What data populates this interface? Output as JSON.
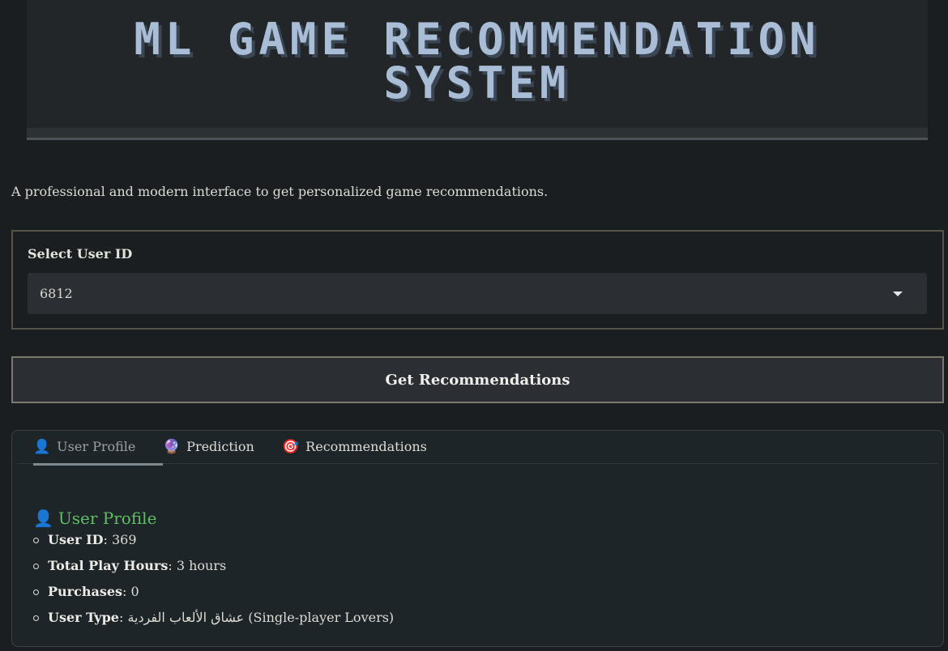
{
  "header": {
    "title_line1": "ML GAME RECOMMENDATION",
    "title_line2": "SYSTEM"
  },
  "subtitle": "A professional and modern interface to get personalized game recommendations.",
  "user_select": {
    "label": "Select User ID",
    "value": "6812",
    "icon": "chevron-down-icon"
  },
  "actions": {
    "get_recommendations_label": "Get Recommendations"
  },
  "tabs": [
    {
      "icon": "👤",
      "icon_name": "user-icon",
      "label": "User Profile",
      "active": true
    },
    {
      "icon": "🔮",
      "icon_name": "crystal-ball-icon",
      "label": "Prediction",
      "active": false
    },
    {
      "icon": "🎯",
      "icon_name": "target-icon",
      "label": "Recommendations",
      "active": false
    }
  ],
  "profile": {
    "icon": "👤",
    "heading": "User Profile",
    "items": [
      {
        "key": "User ID",
        "value": ": 369"
      },
      {
        "key": "Total Play Hours",
        "value": ": 3 hours"
      },
      {
        "key": "Purchases",
        "value": ": 0"
      },
      {
        "key": "User Type",
        "value": ": عشاق الألعاب الفردية (Single-player Lovers)"
      }
    ]
  },
  "colors": {
    "background": "#1b1e20",
    "title": "#a9bdd6",
    "profile_heading": "#5fbf63"
  }
}
